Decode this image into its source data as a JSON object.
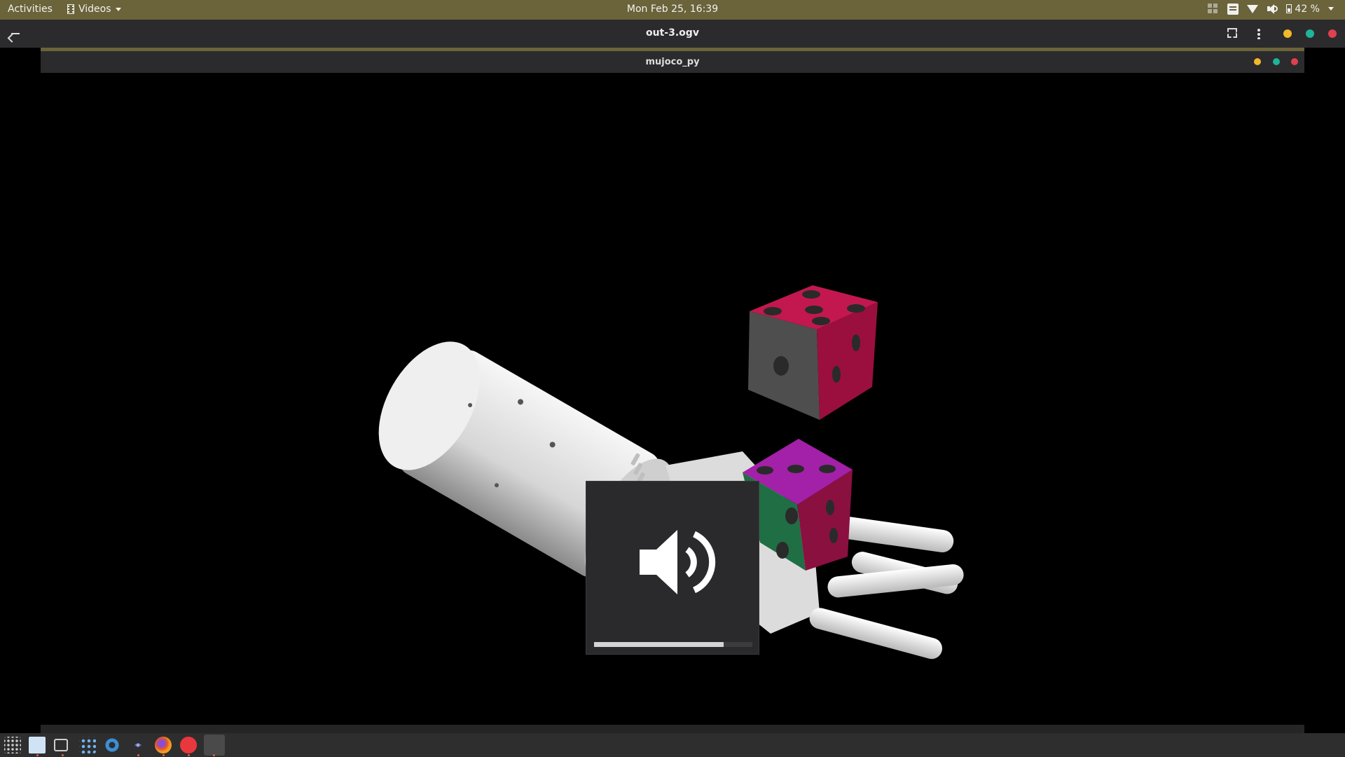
{
  "topbar": {
    "activities": "Activities",
    "app_menu": "Videos",
    "clock": "Mon Feb 25, 16:39",
    "battery": "42 %"
  },
  "header": {
    "title": "out-3.ogv",
    "dots": [
      "#f2b72b",
      "#1fb39a",
      "#e0414f"
    ]
  },
  "inner_window": {
    "title": "mujoco_py",
    "dots": [
      "#f2b72b",
      "#1fb39a",
      "#e0414f"
    ]
  },
  "volume_osd": {
    "icon": "speaker-volume-icon",
    "level": 0.82
  },
  "taskbar": {
    "apps": [
      "apps-grid-icon",
      "files-icon",
      "terminal-icon",
      "network-icon",
      "settings-icon",
      "atom-icon",
      "firefox-icon",
      "vivaldi-icon",
      "video-player-icon"
    ]
  }
}
